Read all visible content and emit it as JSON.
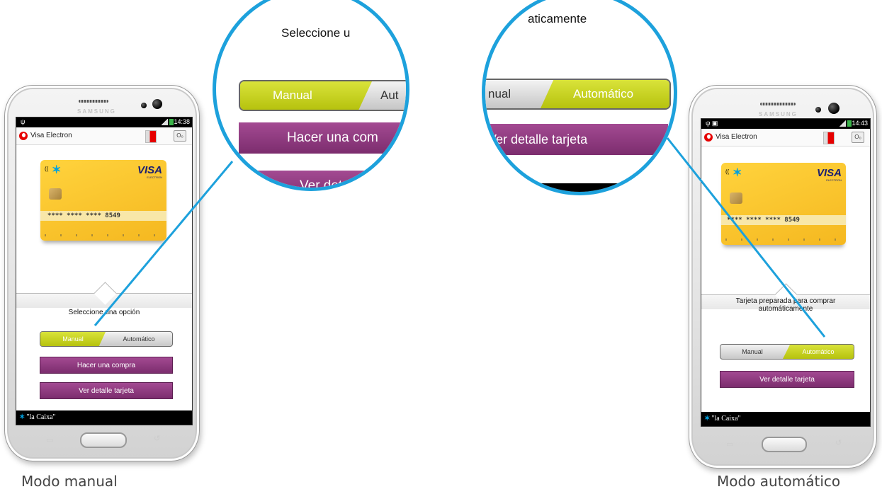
{
  "left_phone": {
    "brand": "SAMSUNG",
    "status_time": "14:38",
    "app_title": "Visa Electron",
    "card": {
      "brand": "VISA",
      "sub": "ELECTRON",
      "number": "**** **** **** 8549"
    },
    "prompt": "Seleccione una opción",
    "toggle": {
      "manual": "Manual",
      "automatic": "Automático",
      "selected": "manual"
    },
    "buttons": {
      "buy": "Hacer una compra",
      "details": "Ver detalle tarjeta"
    },
    "footer": "\"la Caixa\""
  },
  "left_zoom": {
    "prompt": "Seleccione u",
    "manual": "Manual",
    "automatic": "Aut",
    "buy": "Hacer una com",
    "details": "Ver detall"
  },
  "right_zoom": {
    "prompt": "aticamente",
    "manual": "nual",
    "automatic": "Automático",
    "details": "Ver detalle tarjeta"
  },
  "right_phone": {
    "brand": "SAMSUNG",
    "status_time": "14:43",
    "app_title": "Visa Electron",
    "card": {
      "brand": "VISA",
      "sub": "ELECTRON",
      "number": "**** **** **** 8549"
    },
    "prompt_line1": "Tarjeta preparada para comprar",
    "prompt_line2": "automáticamente",
    "toggle": {
      "manual": "Manual",
      "automatic": "Automático",
      "selected": "automatic"
    },
    "buttons": {
      "details": "Ver detalle tarjeta"
    },
    "footer": "\"la Caixa\""
  },
  "captions": {
    "left": "Modo manual",
    "right": "Modo automático"
  },
  "colors": {
    "accent_blue": "#1da1dc",
    "toggle_green": "#c4cf1c",
    "button_purple": "#8e3a80",
    "card_yellow": "#f8c630"
  }
}
